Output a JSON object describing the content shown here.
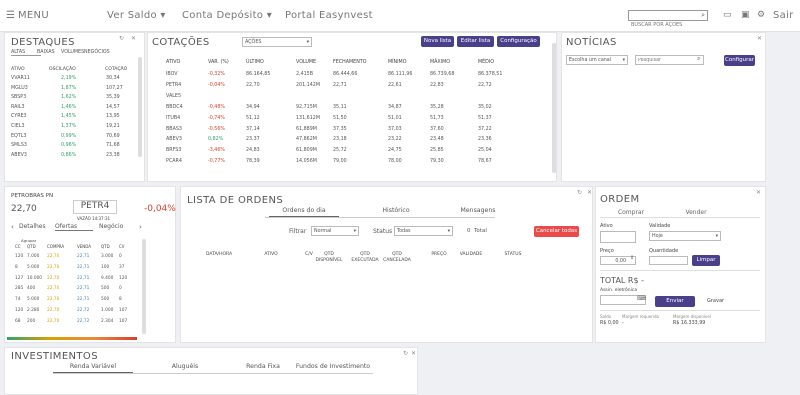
{
  "header": {
    "menu": "MENU",
    "ver_saldo": "Ver Saldo",
    "conta": "Conta Depósito",
    "portal": "Portal Easynvest",
    "search_placeholder": "BUSCAR POR AÇÕES",
    "sair": "Sair"
  },
  "destaques": {
    "title": "DESTAQUES",
    "tabs": [
      "ALTAS",
      "BAIXAS",
      "VOLUMES",
      "NEGÓCIOS"
    ],
    "headers": [
      "ATIVO",
      "OSCILAÇÃO",
      "COTAÇÃO"
    ],
    "rows": [
      [
        "VVAR11",
        "2,19%",
        "30,34"
      ],
      [
        "MGLU3",
        "1,87%",
        "107,27"
      ],
      [
        "SBSP3",
        "1,62%",
        "35,39"
      ],
      [
        "RAIL3",
        "1,46%",
        "14,57"
      ],
      [
        "CYRE3",
        "1,45%",
        "13,95"
      ],
      [
        "CIEL3",
        "1,37%",
        "19,21"
      ],
      [
        "EQTL3",
        "0,99%",
        "70,69"
      ],
      [
        "SMLS3",
        "0,96%",
        "71,68"
      ],
      [
        "ABEV3",
        "0,86%",
        "23,38"
      ]
    ]
  },
  "cotacoes": {
    "title": "COTAÇÕES",
    "select": "AÇÕES",
    "buttons": [
      "Nova lista",
      "Editar lista",
      "Configuração"
    ],
    "headers": [
      "ATIVO",
      "VAR. (%)",
      "ÚLTIMO",
      "VOLUME",
      "FECHAMENTO",
      "MÍNIMO",
      "MÁXIMO",
      "MÉDIO"
    ],
    "rows": [
      [
        "IBOV",
        "-0,32%",
        "86.164,85",
        "2,415B",
        "86.444,66",
        "86.111,96",
        "86.739,68",
        "86.378,51"
      ],
      [
        "PETR4",
        "-0,04%",
        "22,70",
        "201,142M",
        "22,71",
        "22,61",
        "22,83",
        "22,72"
      ],
      [
        "VALE5",
        "",
        "",
        "",
        "",
        "",
        "",
        ""
      ],
      [
        "BBDC4",
        "-0,48%",
        "34,94",
        "92,715M",
        "35,11",
        "34,87",
        "35,28",
        "35,02"
      ],
      [
        "ITUB4",
        "-0,74%",
        "51,12",
        "131,612M",
        "51,50",
        "51,01",
        "51,73",
        "51,37"
      ],
      [
        "BBAS3",
        "-0,56%",
        "37,14",
        "61,889M",
        "37,35",
        "37,03",
        "37,60",
        "37,22"
      ],
      [
        "ABEV3",
        "0,82%",
        "23,37",
        "47,862M",
        "23,18",
        "23,22",
        "23,48",
        "23,36"
      ],
      [
        "BRFS3",
        "-3,46%",
        "24,83",
        "61,809M",
        "25,72",
        "24,75",
        "25,85",
        "25,04"
      ],
      [
        "PCAR4",
        "-0,77%",
        "78,39",
        "14,056M",
        "79,00",
        "78,00",
        "79,30",
        "78,67"
      ]
    ]
  },
  "noticias": {
    "title": "NOTÍCIAS",
    "select": "Escolha um canal",
    "placeholder": "Pesquisar",
    "button": "Configurar"
  },
  "book": {
    "name": "PETROBRAS PN",
    "price": "22,70",
    "ticker": "PETR4",
    "var": "-0,04%",
    "sub": "VAZÃO",
    "time": "14:37:31",
    "tabs": [
      "Detalhes",
      "Ofertas",
      "Negócio"
    ],
    "agrupar": "Agrupar",
    "headers": [
      "CC",
      "QTD",
      "COMPRA",
      "VENDA",
      "QTD",
      "CV"
    ],
    "rows": [
      [
        "120",
        "7.000",
        "22,70",
        "22,71",
        "3.000",
        "0"
      ],
      [
        "8",
        "5.000",
        "22,70",
        "22,71",
        "100",
        "37"
      ],
      [
        "127",
        "10.000",
        "22,70",
        "22,71",
        "9.400",
        "120"
      ],
      [
        "285",
        "400",
        "22,70",
        "22,71",
        "500",
        "0"
      ],
      [
        "74",
        "5.000",
        "22,70",
        "22,71",
        "500",
        "8"
      ],
      [
        "120",
        "2.280",
        "22,70",
        "22,72",
        "1.000",
        "107"
      ],
      [
        "68",
        "200",
        "22,70",
        "22,72",
        "2.304",
        "107"
      ]
    ]
  },
  "lista": {
    "title": "LISTA DE ORDENS",
    "tabs": [
      "Ordens do dia",
      "Histórico",
      "Mensagens"
    ],
    "filtrar": "Filtrar",
    "filtrar_val": "Normal",
    "status": "Status",
    "status_val": "Todas",
    "total_n": "0",
    "total": "Total",
    "cancel": "Cancelar todas",
    "headers": [
      "DATA/HORA",
      "ATIVO",
      "C/V",
      "QTD DISPONÍVEL",
      "QTD EXECUTADA",
      "QTD CANCELADA",
      "PREÇO",
      "VALIDADE",
      "STATUS"
    ]
  },
  "ordem": {
    "title": "ORDEM",
    "tabs": [
      "Comprar",
      "Vender"
    ],
    "ativo": "Ativo",
    "validade": "Validade",
    "validade_val": "Hoje",
    "preco": "Preço",
    "preco_val": "0,00",
    "quantidade": "Quantidade",
    "limpar": "Limpar",
    "total": "TOTAL R$ -",
    "assin": "Assin. eletrônica",
    "enviar": "Enviar",
    "gravar": "Gravar",
    "saldo": "Saldo",
    "saldo_val": "R$ 0,00",
    "margem_req": "Margem requerida",
    "margem_req_val": "-",
    "margem_disp": "Margem disponível",
    "margem_disp_val": "R$ 16.333,99"
  },
  "invest": {
    "title": "INVESTIMENTOS",
    "tabs": [
      "Renda Variável",
      "Aluguéis",
      "Renda Fixa",
      "Fundos de Investimento"
    ]
  },
  "colors": {
    "accent": "#4a3f8a",
    "up": "#2ea36b",
    "down": "#d6402c",
    "cancel": "#e94b4b"
  }
}
